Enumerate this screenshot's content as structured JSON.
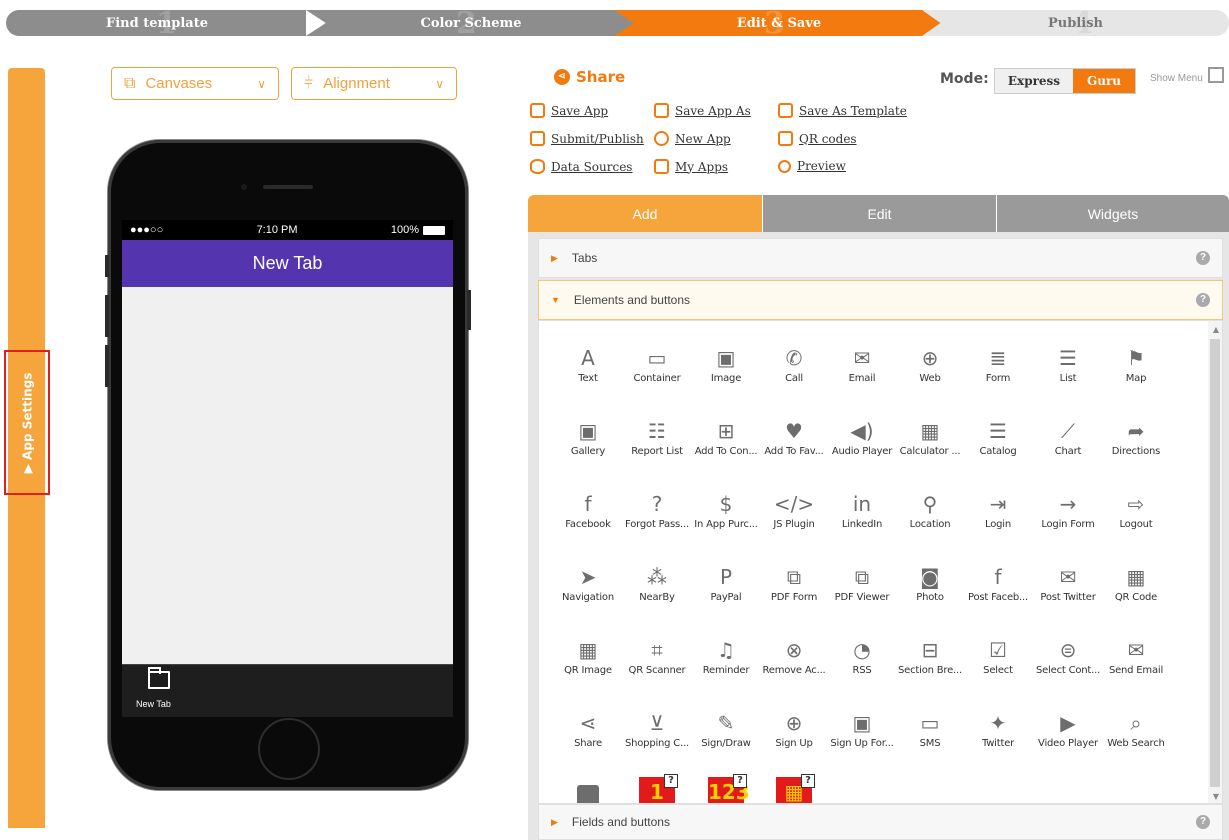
{
  "wizard": {
    "steps": [
      {
        "label": "Find template",
        "num": "1"
      },
      {
        "label": "Color Scheme",
        "num": "2"
      },
      {
        "label": "Edit & Save",
        "num": "3"
      },
      {
        "label": "Publish",
        "num": "4"
      }
    ],
    "active_color": "#f27a0e"
  },
  "sidebar": {
    "app_settings_label": "▶ App Settings"
  },
  "toolbar": {
    "canvases_label": "Canvases",
    "alignment_label": "Alignment"
  },
  "phone": {
    "carrier": "●●●○○",
    "time": "7:10 PM",
    "battery": "100%",
    "header_title": "New Tab",
    "header_color": "#5534b0",
    "tab_label": "New Tab"
  },
  "actions": {
    "share_label": "Share",
    "save_app": "Save App",
    "save_app_as": "Save App As",
    "save_as_template": "Save As Template",
    "submit_publish": "Submit/Publish",
    "new_app": "New App",
    "qr_codes": "QR codes",
    "data_sources": "Data Sources",
    "my_apps": "My Apps",
    "preview": "Preview"
  },
  "mode": {
    "label": "Mode:",
    "express": "Express",
    "guru": "Guru",
    "selected": "Guru",
    "show_menu": "Show Menu"
  },
  "tabs": {
    "add": "Add",
    "edit": "Edit",
    "widgets": "Widgets"
  },
  "accordion": {
    "tabs": "Tabs",
    "elements": "Elements and buttons",
    "fields": "Fields and buttons"
  },
  "elements": [
    {
      "label": "Text",
      "icon": "A"
    },
    {
      "label": "Container",
      "icon": "▭"
    },
    {
      "label": "Image",
      "icon": "▣"
    },
    {
      "label": "Call",
      "icon": "✆"
    },
    {
      "label": "Email",
      "icon": "✉"
    },
    {
      "label": "Web",
      "icon": "⊕"
    },
    {
      "label": "Form",
      "icon": "≣"
    },
    {
      "label": "List",
      "icon": "☰"
    },
    {
      "label": "Map",
      "icon": "⚑"
    },
    {
      "label": "Gallery",
      "icon": "▣"
    },
    {
      "label": "Report List",
      "icon": "☷"
    },
    {
      "label": "Add To Con...",
      "icon": "⊞"
    },
    {
      "label": "Add To Fav...",
      "icon": "♥"
    },
    {
      "label": "Audio Player",
      "icon": "◀)"
    },
    {
      "label": "Calculator ...",
      "icon": "▦"
    },
    {
      "label": "Catalog",
      "icon": "☰"
    },
    {
      "label": "Chart",
      "icon": "⟋"
    },
    {
      "label": "Directions",
      "icon": "➦"
    },
    {
      "label": "Facebook",
      "icon": "f"
    },
    {
      "label": "Forgot Pass...",
      "icon": "?"
    },
    {
      "label": "In App Purc...",
      "icon": "$"
    },
    {
      "label": "JS Plugin",
      "icon": "</>"
    },
    {
      "label": "LinkedIn",
      "icon": "in"
    },
    {
      "label": "Location",
      "icon": "⚲"
    },
    {
      "label": "Login",
      "icon": "⇥"
    },
    {
      "label": "Login Form",
      "icon": "→"
    },
    {
      "label": "Logout",
      "icon": "⇨"
    },
    {
      "label": "Navigation",
      "icon": "➤"
    },
    {
      "label": "NearBy",
      "icon": "⁂"
    },
    {
      "label": "PayPal",
      "icon": "P"
    },
    {
      "label": "PDF Form",
      "icon": "⧉"
    },
    {
      "label": "PDF Viewer",
      "icon": "⧉"
    },
    {
      "label": "Photo",
      "icon": "◙"
    },
    {
      "label": "Post Faceb...",
      "icon": "f"
    },
    {
      "label": "Post Twitter",
      "icon": "✉"
    },
    {
      "label": "QR Code",
      "icon": "▦"
    },
    {
      "label": "QR Image",
      "icon": "▦"
    },
    {
      "label": "QR Scanner",
      "icon": "⌗"
    },
    {
      "label": "Reminder",
      "icon": "♫"
    },
    {
      "label": "Remove Ac...",
      "icon": "⊗"
    },
    {
      "label": "RSS",
      "icon": "◔"
    },
    {
      "label": "Section Bre...",
      "icon": "⊟"
    },
    {
      "label": "Select",
      "icon": "☑"
    },
    {
      "label": "Select Cont...",
      "icon": "⊜"
    },
    {
      "label": "Send Email",
      "icon": "✉"
    },
    {
      "label": "Share",
      "icon": "⋖"
    },
    {
      "label": "Shopping C...",
      "icon": "⊻"
    },
    {
      "label": "Sign/Draw",
      "icon": "✎"
    },
    {
      "label": "Sign Up",
      "icon": "⊕"
    },
    {
      "label": "Sign Up For...",
      "icon": "▣"
    },
    {
      "label": "SMS",
      "icon": "▭"
    },
    {
      "label": "Twitter",
      "icon": "✦"
    },
    {
      "label": "Video Player",
      "icon": "▶"
    },
    {
      "label": "Web Search",
      "icon": "⌕"
    }
  ],
  "extra_widgets": [
    {
      "label": "",
      "text": "▶"
    },
    {
      "label": "",
      "text": "1"
    },
    {
      "label": "",
      "text": "123"
    },
    {
      "label": "",
      "text": "▦"
    }
  ]
}
